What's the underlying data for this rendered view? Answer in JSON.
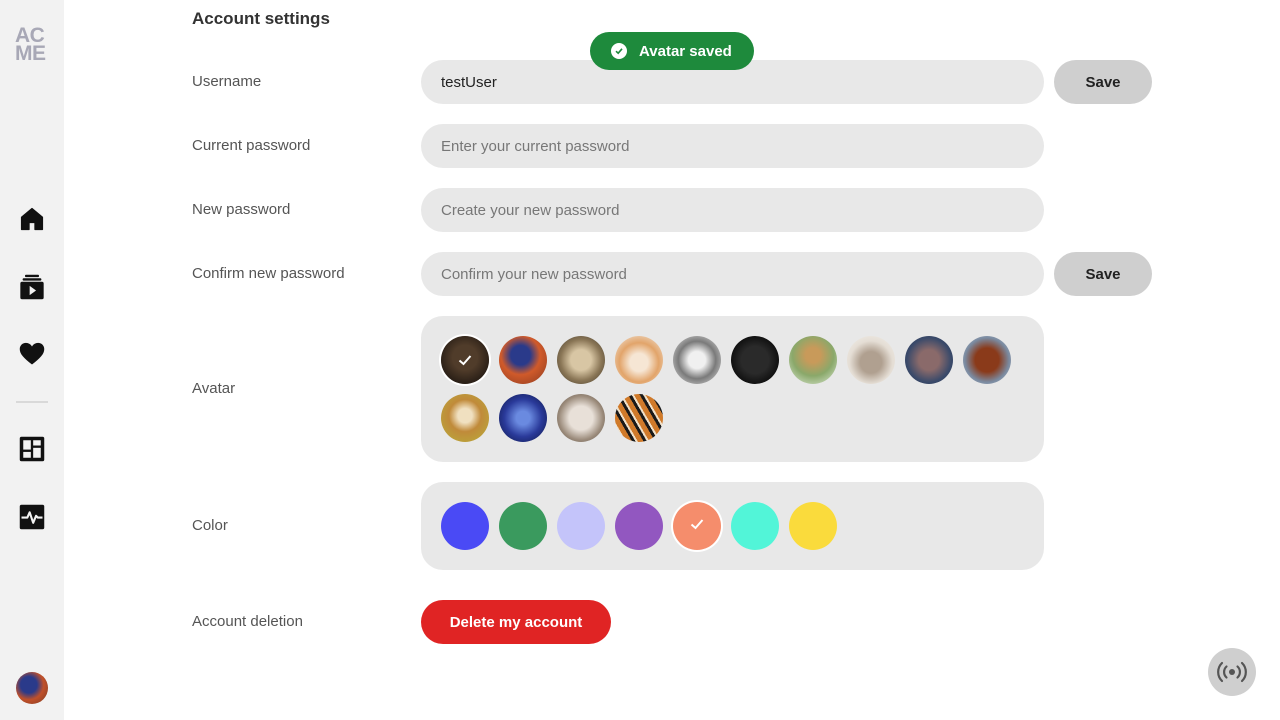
{
  "sidebar": {
    "logo_line1": "AC",
    "logo_line2": "ME",
    "nav": [
      {
        "icon": "home-icon"
      },
      {
        "icon": "video-library-icon"
      },
      {
        "icon": "heart-icon"
      },
      {
        "icon": "dashboard-icon"
      },
      {
        "icon": "activity-icon"
      }
    ],
    "user_avatar": "parrot"
  },
  "page": {
    "title": "Account settings"
  },
  "toast": {
    "text": "Avatar saved",
    "color": "#1e8a3c"
  },
  "form": {
    "username": {
      "label": "Username",
      "value": "testUser",
      "save_label": "Save"
    },
    "current_password": {
      "label": "Current password",
      "placeholder": "Enter your current password"
    },
    "new_password": {
      "label": "New password",
      "placeholder": "Create your new password"
    },
    "confirm_password": {
      "label": "Confirm new password",
      "placeholder": "Confirm your new password",
      "save_label": "Save"
    },
    "avatar": {
      "label": "Avatar",
      "options": [
        "bear",
        "parrot",
        "owl",
        "shiba",
        "pitbull",
        "pug",
        "giraffe",
        "hedgehog",
        "hippo",
        "horse",
        "gazelle",
        "jellyfish",
        "sheep",
        "tiger"
      ],
      "selected": "bear"
    },
    "color": {
      "label": "Color",
      "options": [
        "#4a4af5",
        "#3a9a5e",
        "#c4c4fa",
        "#9257c0",
        "#f58d6c",
        "#52f5d8",
        "#fadb3c"
      ],
      "selected": "#f58d6c"
    },
    "deletion": {
      "label": "Account deletion",
      "button_label": "Delete my account",
      "button_color": "#e02424"
    }
  }
}
